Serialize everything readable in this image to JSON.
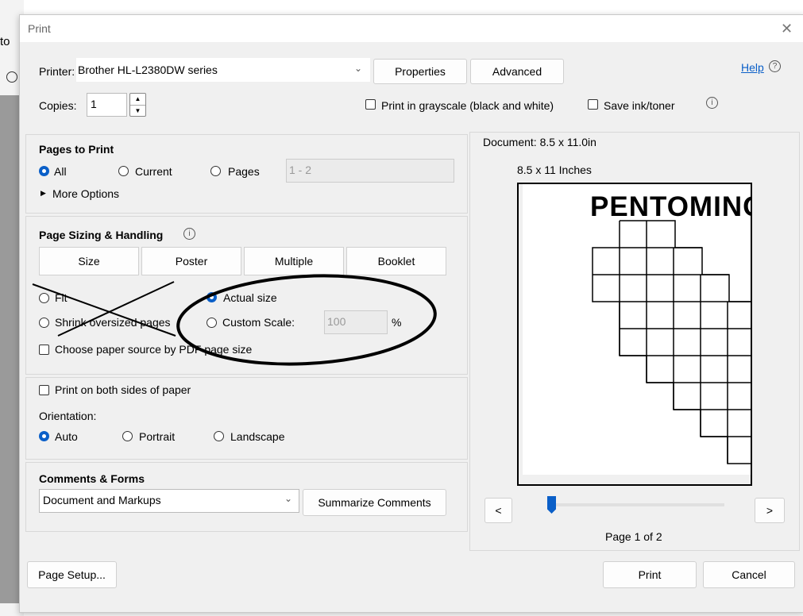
{
  "background": {
    "left_fragment": "to"
  },
  "dialog": {
    "title": "Print",
    "close_glyph": "✕"
  },
  "printer": {
    "label": "Printer:",
    "selected": "Brother HL-L2380DW series",
    "properties_label": "Properties",
    "advanced_label": "Advanced",
    "help_label": "Help",
    "copies_label": "Copies:",
    "copies_value": "1",
    "grayscale_label": "Print in grayscale (black and white)",
    "save_ink_label": "Save ink/toner"
  },
  "pages_to_print": {
    "title": "Pages to Print",
    "all_label": "All",
    "current_label": "Current",
    "pages_label": "Pages",
    "pages_value": "1 - 2",
    "more_options_label": "More Options",
    "selected": "All"
  },
  "page_sizing": {
    "title": "Page Sizing & Handling",
    "tabs": [
      {
        "label": "Size"
      },
      {
        "label": "Poster"
      },
      {
        "label": "Multiple"
      },
      {
        "label": "Booklet"
      }
    ],
    "fit_label": "Fit",
    "actual_size_label": "Actual size",
    "shrink_label": "Shrink oversized pages",
    "custom_scale_label": "Custom Scale:",
    "custom_scale_value": "100",
    "percent_label": "%",
    "paper_source_label": "Choose paper source by PDF page size",
    "selected": "Actual size"
  },
  "duplex": {
    "both_sides_label": "Print on both sides of paper",
    "orientation_label": "Orientation:",
    "auto_label": "Auto",
    "portrait_label": "Portrait",
    "landscape_label": "Landscape",
    "selected": "Auto"
  },
  "comments_forms": {
    "title": "Comments & Forms",
    "selected": "Document and Markups",
    "summarize_label": "Summarize Comments"
  },
  "preview": {
    "document_label": "Document: 8.5 x 11.0in",
    "paper_label": "8.5 x 11 Inches",
    "preview_heading": "PENTOMINO",
    "prev_label": "<",
    "next_label": ">",
    "page_indicator": "Page 1 of 2"
  },
  "footer": {
    "page_setup_label": "Page Setup...",
    "print_label": "Print",
    "cancel_label": "Cancel"
  },
  "colors": {
    "accent": "#0a5fc8",
    "help_link": "#0a5fc8",
    "dialog_bg": "#f0f0f0"
  }
}
